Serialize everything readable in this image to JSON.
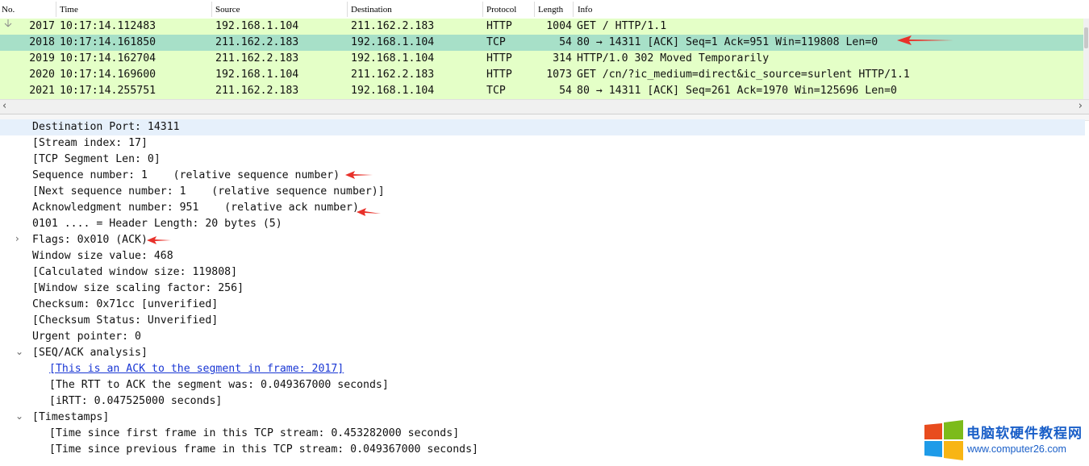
{
  "packet_list": {
    "columns": [
      "No.",
      "Time",
      "Source",
      "Destination",
      "Protocol",
      "Length",
      "Info"
    ],
    "rows": [
      {
        "no": "2017",
        "time": "10:17:14.112483",
        "src": "192.168.1.104",
        "dst": "211.162.2.183",
        "proto": "HTTP",
        "len": "1004",
        "info": "GET / HTTP/1.1"
      },
      {
        "no": "2018",
        "time": "10:17:14.161850",
        "src": "211.162.2.183",
        "dst": "192.168.1.104",
        "proto": "TCP",
        "len": "54",
        "info": "80 → 14311 [ACK] Seq=1 Ack=951 Win=119808 Len=0"
      },
      {
        "no": "2019",
        "time": "10:17:14.162704",
        "src": "211.162.2.183",
        "dst": "192.168.1.104",
        "proto": "HTTP",
        "len": "314",
        "info": "HTTP/1.0 302 Moved Temporarily"
      },
      {
        "no": "2020",
        "time": "10:17:14.169600",
        "src": "192.168.1.104",
        "dst": "211.162.2.183",
        "proto": "HTTP",
        "len": "1073",
        "info": "GET /cn/?ic_medium=direct&ic_source=surlent HTTP/1.1"
      },
      {
        "no": "2021",
        "time": "10:17:14.255751",
        "src": "211.162.2.183",
        "dst": "192.168.1.104",
        "proto": "TCP",
        "len": "54",
        "info": "80 → 14311 [ACK] Seq=261 Ack=1970 Win=125696 Len=0"
      }
    ],
    "selected_row": 1,
    "row_color": "#e4ffc7",
    "selected_color": "#a7e0c8"
  },
  "details": {
    "lines": [
      {
        "text": "Destination Port: 14311"
      },
      {
        "text": "[Stream index: 17]"
      },
      {
        "text": "[TCP Segment Len: 0]"
      },
      {
        "text": "Sequence number: 1    (relative sequence number)"
      },
      {
        "text": "[Next sequence number: 1    (relative sequence number)]"
      },
      {
        "text": "Acknowledgment number: 951    (relative ack number)"
      },
      {
        "text": "0101 .... = Header Length: 20 bytes (5)"
      },
      {
        "text": "Flags: 0x010 (ACK)",
        "expander": "collapsed"
      },
      {
        "text": "Window size value: 468"
      },
      {
        "text": "[Calculated window size: 119808]"
      },
      {
        "text": "[Window size scaling factor: 256]"
      },
      {
        "text": "Checksum: 0x71cc [unverified]"
      },
      {
        "text": "[Checksum Status: Unverified]"
      },
      {
        "text": "Urgent pointer: 0"
      },
      {
        "text": "[SEQ/ACK analysis]",
        "expander": "expanded"
      },
      {
        "text": "[This is an ACK to the segment in frame: 2017]",
        "link": true
      },
      {
        "text": "[The RTT to ACK the segment was: 0.049367000 seconds]"
      },
      {
        "text": "[iRTT: 0.047525000 seconds]"
      },
      {
        "text": "[Timestamps]",
        "expander": "expanded"
      },
      {
        "text": "[Time since first frame in this TCP stream: 0.453282000 seconds]"
      },
      {
        "text": "[Time since previous frame in this TCP stream: 0.049367000 seconds]"
      }
    ]
  },
  "watermark": {
    "name": "电脑软硬件教程网",
    "url": "www.computer26.com"
  },
  "colors": {
    "annotation_arrow": "#e8312a",
    "link": "#1a37d4",
    "highlight": "#e6f0fb"
  }
}
